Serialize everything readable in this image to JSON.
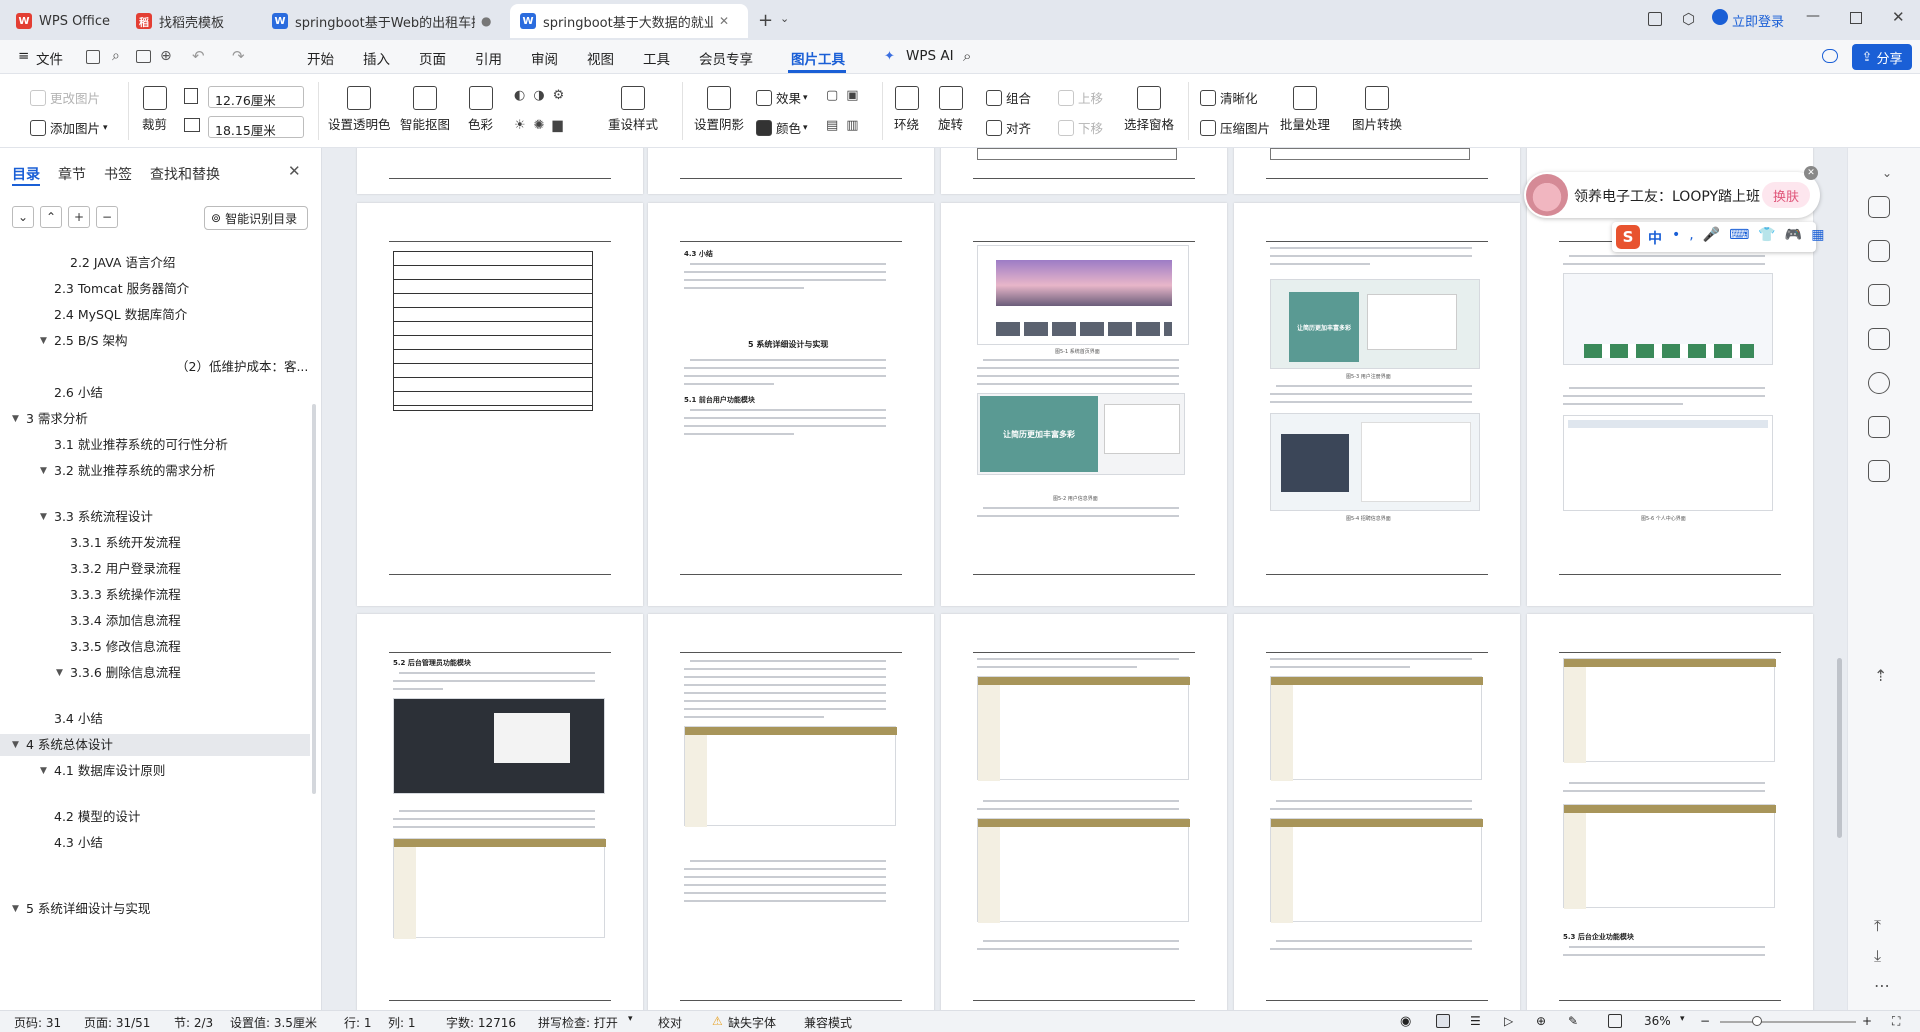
{
  "tabs": [
    {
      "label": "WPS Office",
      "icon": "wps-logo",
      "active": false
    },
    {
      "label": "找稻壳模板",
      "icon": "docer-icon",
      "active": false
    },
    {
      "label": "springboot基于Web的出租车拼车",
      "icon": "word-doc-icon",
      "active": false
    },
    {
      "label": "springboot基于大数据的就业",
      "icon": "word-doc-icon",
      "active": true
    }
  ],
  "title_bar": {
    "login": "立即登录"
  },
  "menu": {
    "file": "文件",
    "items": [
      "开始",
      "插入",
      "页面",
      "引用",
      "审阅",
      "视图",
      "工具",
      "会员专享",
      "图片工具",
      "WPS AI"
    ],
    "active": "图片工具",
    "share": "分享"
  },
  "ribbon": {
    "change_image": "更改图片",
    "add_image": "添加图片",
    "crop": "裁剪",
    "width_value": "12.76厘米",
    "height_value": "18.15厘米",
    "transparent": "设置透明色",
    "smart_cutout": "智能抠图",
    "color": "色彩",
    "reset_style": "重设样式",
    "shadow": "设置阴影",
    "effect": "效果",
    "border_color": "颜色",
    "wrap": "环绕",
    "rotate": "旋转",
    "group": "组合",
    "align": "对齐",
    "bring_forward": "上移",
    "send_backward": "下移",
    "selection_pane": "选择窗格",
    "sharpen": "清晰化",
    "compress": "压缩图片",
    "batch": "批量处理",
    "convert": "图片转换"
  },
  "left_pane": {
    "tabs": [
      "目录",
      "章节",
      "书签",
      "查找和替换"
    ],
    "smart_toc": "智能识别目录",
    "toc": [
      {
        "text": "2.2 JAVA 语言介绍",
        "level": 3
      },
      {
        "text": "2.3 Tomcat 服务器简介",
        "level": 2
      },
      {
        "text": "2.4 MySQL 数据库简介",
        "level": 2
      },
      {
        "text": "2.5 B/S 架构",
        "level": 2,
        "expanded": true
      },
      {
        "text": "（2）低维护成本：客...",
        "level": 4
      },
      {
        "text": "2.6 小结",
        "level": 2
      },
      {
        "text": "3  需求分析",
        "level": 1,
        "expanded": true
      },
      {
        "text": "3.1 就业推荐系统的可行性分析",
        "level": 2
      },
      {
        "text": "3.2 就业推荐系统的需求分析",
        "level": 2,
        "expanded": true
      },
      {
        "text": "3.3 系统流程设计",
        "level": 2,
        "expanded": true
      },
      {
        "text": "3.3.1   系统开发流程",
        "level": 3
      },
      {
        "text": "3.3.2   用户登录流程",
        "level": 3
      },
      {
        "text": "3.3.3   系统操作流程",
        "level": 3
      },
      {
        "text": "3.3.4   添加信息流程",
        "level": 3
      },
      {
        "text": "3.3.5   修改信息流程",
        "level": 3
      },
      {
        "text": "3.3.6   删除信息流程",
        "level": 3,
        "expanded": true
      },
      {
        "text": "3.4 小结",
        "level": 2
      },
      {
        "text": "4  系统总体设计",
        "level": 1,
        "expanded": true,
        "selected": true
      },
      {
        "text": "4.1    数据库设计原则",
        "level": 2,
        "expanded": true
      },
      {
        "text": "4.2 模型的设计",
        "level": 2
      },
      {
        "text": "4.3 小结",
        "level": 2
      },
      {
        "text": "5  系统详细设计与实现",
        "level": 1,
        "expanded": true
      }
    ]
  },
  "pages_text": {
    "p2_h1": "4.3 小结",
    "p2_h2": "5  系统详细设计与实现",
    "p2_h3": "5.1 前台用户功能模块",
    "p6_h": "5.2 后台管理员功能模块",
    "p10_h": "5.3 后台企业功能模块",
    "banner": "让简历更加丰富多彩",
    "cap_home": "图5-1 系统首页界面",
    "cap_detail": "图5-2 用户信息界面",
    "cap_register": "图5-3 用户注册界面",
    "cap_jobs": "图5-4 招聘信息界面",
    "cap_personal": "图5-6 个人中心界面"
  },
  "notification": {
    "name": "领养电子工友：LOOPY踏上班",
    "action": "换肤"
  },
  "ime": {
    "label": "中"
  },
  "status": {
    "page_no": "页码: 31",
    "page_count": "页面: 31/51",
    "section": "节: 2/3",
    "setting": "设置值: 3.5厘米",
    "row": "行: 1",
    "col": "列: 1",
    "word_count": "字数: 12716",
    "spell": "拼写检查: 打开",
    "proof": "校对",
    "missing_font": "缺失字体",
    "compat": "兼容模式",
    "zoom": "36%"
  },
  "colors": {
    "accent": "#1a5fd6",
    "wps_red": "#e33e33",
    "doc_blue": "#2b6cde",
    "gold": "#a8955a",
    "banner_teal": "#5a9a93",
    "warning": "#e8a42a"
  }
}
